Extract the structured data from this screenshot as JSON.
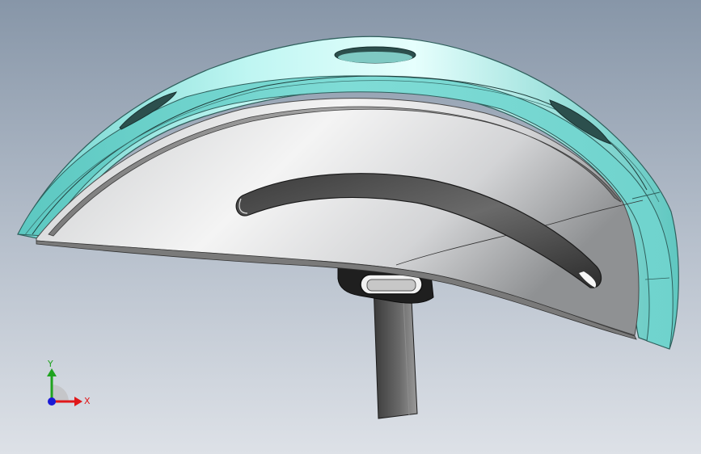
{
  "viewport": {
    "background_top": "#8a97a9",
    "background_bottom": "#d9dee6"
  },
  "model": {
    "shell_color": "#8fe6e0",
    "shell_edge_color": "#2f5f5c",
    "liner_color": "#d8dadc",
    "strap_color": "#4a4a4a",
    "buckle_color": "#222222"
  },
  "triad": {
    "x_label": "X",
    "y_label": "Y",
    "x_color": "#e0181a",
    "y_color": "#1fa31f",
    "origin_color": "#1a1ad6"
  }
}
